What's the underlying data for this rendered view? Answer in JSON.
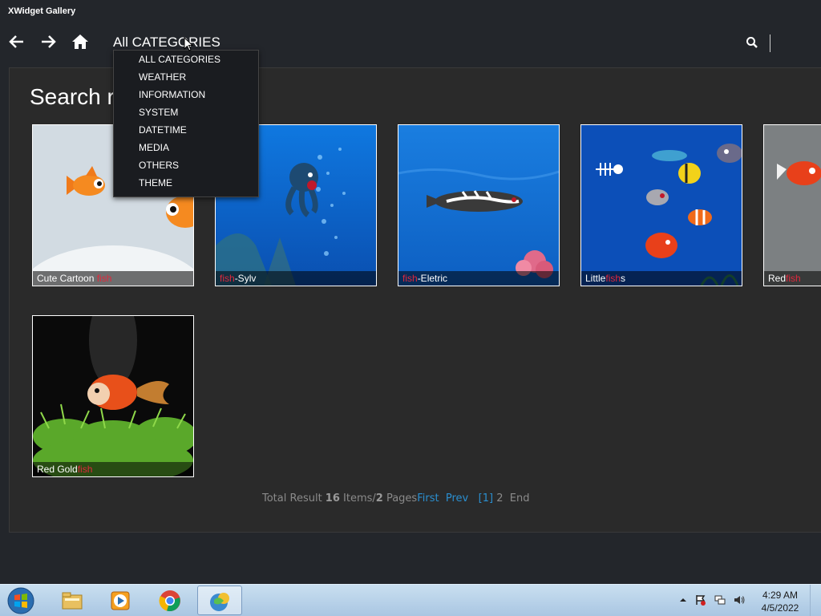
{
  "window": {
    "title": "XWidget Gallery"
  },
  "nav": {
    "back_icon": "arrow-left-icon",
    "forward_icon": "arrow-right-icon",
    "home_icon": "home-icon",
    "category_selected": "All CATEGORIES",
    "search_icon": "search-icon",
    "search_value": ""
  },
  "dropdown": {
    "items": [
      "ALL CATEGORIES",
      "WEATHER",
      "INFORMATION",
      "SYSTEM",
      "DATETIME",
      "MEDIA",
      "OTHERS",
      "THEME"
    ]
  },
  "main": {
    "heading": "Search r",
    "results": [
      {
        "pre": "Cute Cartoon ",
        "hl": "fish",
        "post": ""
      },
      {
        "pre": "",
        "hl": "fish",
        "post": "-Sylv"
      },
      {
        "pre": "",
        "hl": "fish",
        "post": "-Eletric"
      },
      {
        "pre": "Little",
        "hl": "fish",
        "post": "s"
      },
      {
        "pre": "Red",
        "hl": "fish",
        "post": ""
      },
      {
        "pre": "Red Gold",
        "hl": "fish",
        "post": ""
      }
    ]
  },
  "pager": {
    "total_label": "Total Result ",
    "items_count": "16",
    "items_label": " Items/",
    "pages_count": "2",
    "pages_label": " Pages",
    "first": "First",
    "prev": "Prev",
    "current": "[1]",
    "page2": "2",
    "end": "End"
  },
  "taskbar": {
    "apps": [
      "windows-explorer-icon",
      "media-player-icon",
      "chrome-icon",
      "xwidget-icon"
    ],
    "active_app": "xwidget-icon",
    "tray": [
      "show-hidden-icons-icon",
      "action-center-flag-icon",
      "network-icon",
      "volume-icon"
    ],
    "time": "4:29 AM",
    "date": "4/5/2022"
  },
  "colors": {
    "highlight": "#e0283c",
    "link": "#2a8fd0",
    "background": "#23262b"
  }
}
